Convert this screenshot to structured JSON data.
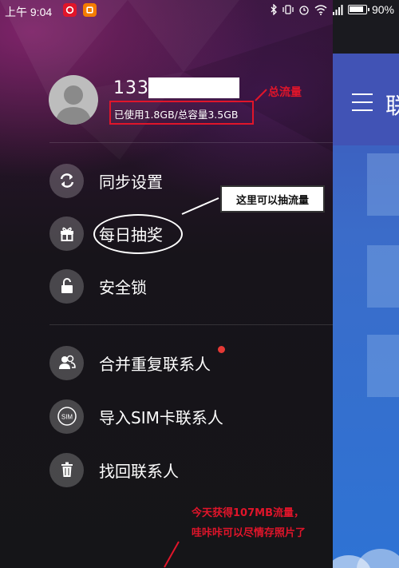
{
  "status_bar": {
    "time": "上午 9:04",
    "battery": "90%",
    "app_icons": [
      {
        "name": "netease-music-icon",
        "color": "#e0152a"
      },
      {
        "name": "orange-app-icon",
        "color": "#f57c00"
      }
    ],
    "system_icons": [
      "bluetooth-icon",
      "vibrate-icon",
      "alarm-icon",
      "wifi-icon",
      "signal-icon",
      "battery-icon"
    ]
  },
  "profile": {
    "phone": "133",
    "quota_text": "已使用1.8GB/总容量3.5GB"
  },
  "menu": {
    "items": [
      {
        "label": "同步设置",
        "icon": "sync-icon"
      },
      {
        "label": "每日抽奖",
        "icon": "gift-icon"
      },
      {
        "label": "安全锁",
        "icon": "lock-icon"
      },
      {
        "label": "合并重复联系人",
        "icon": "contacts-merge-icon"
      },
      {
        "label": "导入SIM卡联系人",
        "icon": "sim-card-icon",
        "icon_text": "SIM"
      },
      {
        "label": "找回联系人",
        "icon": "trash-icon"
      }
    ]
  },
  "annotations": {
    "total_traffic": "总流量",
    "lottery_hint": "这里可以抽流量",
    "result_line1": "今天获得107MB流量，",
    "result_line2": "哇咔咔可以尽情存照片了"
  },
  "app_panel": {
    "title": "联"
  },
  "colors": {
    "annotation_red": "#e0152a",
    "toolbar_blue": "#4153b5",
    "panel_blue": "#2e73d4"
  }
}
